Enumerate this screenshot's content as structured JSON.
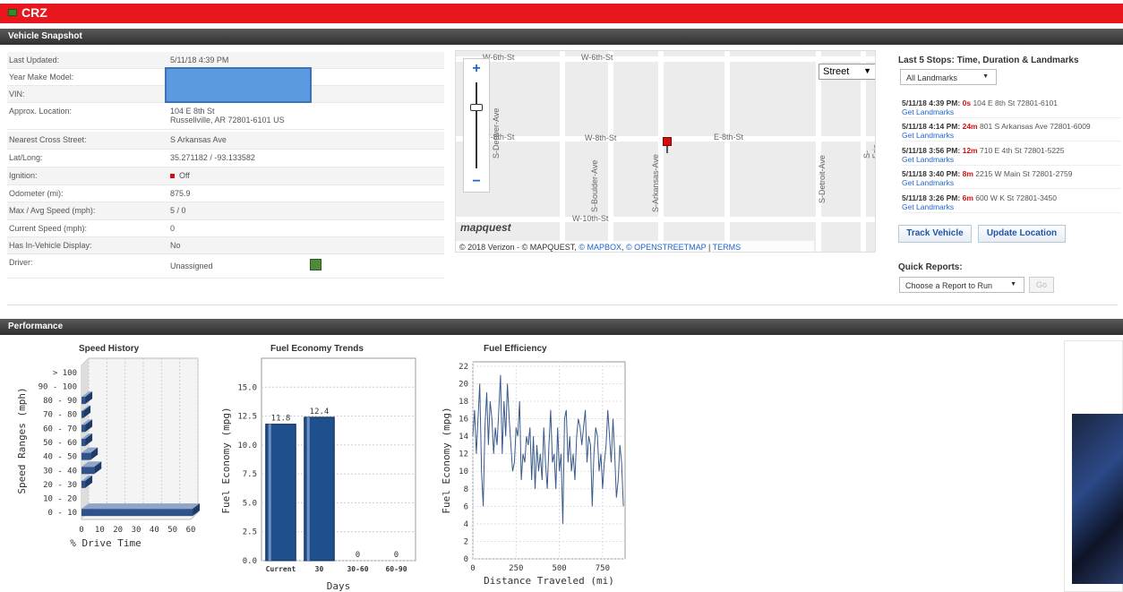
{
  "app": {
    "title": "CRZ"
  },
  "vehicle_section": {
    "title": "Vehicle Snapshot"
  },
  "vehicle_fields": [
    {
      "label": "Last Updated:",
      "value": "5/11/18 4:39 PM"
    },
    {
      "label": "Year Make Model:",
      "value": ""
    },
    {
      "label": "VIN:",
      "value": ""
    },
    {
      "label": "Approx. Location:",
      "value": "104 E 8th St",
      "value2": "Russellville, AR 72801-6101 US"
    },
    {
      "label": "Nearest Cross Street:",
      "value": "S Arkansas Ave"
    },
    {
      "label": "Lat/Long:",
      "value": "35.271182 / -93.133582"
    },
    {
      "label": "Ignition:",
      "value": "Off"
    },
    {
      "label": "Odometer (mi):",
      "value": "875.9"
    },
    {
      "label": "Max / Avg Speed (mph):",
      "value": "5 / 0"
    },
    {
      "label": "Current Speed (mph):",
      "value": "0"
    },
    {
      "label": "Has In-Vehicle Display:",
      "value": "No"
    },
    {
      "label": "Driver:",
      "value": "Unassigned"
    }
  ],
  "map": {
    "zoom_in": "+",
    "zoom_out": "−",
    "map_type": "Street",
    "streets": {
      "w6th_a": "W-6th-St",
      "w6th_b": "W-6th-St",
      "w8th_a": "W-8th-St",
      "w8th_b": "W-8th-St",
      "e8th": "E-8th-St",
      "w10th": "W-10th-St",
      "s_denver": "S-Denver-Ave",
      "s_boulder": "S-Boulder-Ave",
      "s_arkansas": "S-Arkansas-Ave",
      "s_detroit": "S-Detroit-Ave",
      "s_erie": "S-Erie-Ave"
    },
    "logo": "mapquest",
    "attribution": "© 2018 Verizon - © MAPQUEST, ",
    "attr_links": [
      "© MAPBOX",
      "© OPENSTREETMAP",
      "TERMS"
    ],
    "separator": " | "
  },
  "stops": {
    "title": "Last 5 Stops: Time, Duration & Landmarks",
    "filter": "All Landmarks",
    "items": [
      {
        "time": "5/11/18 4:39 PM:",
        "duration": "0s",
        "address": "104 E 8th St 72801-6101",
        "link": "Get Landmarks"
      },
      {
        "time": "5/11/18 4:14 PM:",
        "duration": "24m",
        "address": "801 S Arkansas Ave 72801-6009",
        "link": "Get Landmarks"
      },
      {
        "time": "5/11/18 3:56 PM:",
        "duration": "12m",
        "address": "710 E 4th St 72801-5225",
        "link": "Get Landmarks"
      },
      {
        "time": "5/11/18 3:40 PM:",
        "duration": "8m",
        "address": "2215 W Main St 72801-2759",
        "link": "Get Landmarks"
      },
      {
        "time": "5/11/18 3:26 PM:",
        "duration": "6m",
        "address": "600 W K St 72801-3450",
        "link": "Get Landmarks"
      }
    ],
    "track_button": "Track Vehicle",
    "update_button": "Update Location"
  },
  "quick_reports": {
    "title": "Quick Reports:",
    "select": "Choose a Report to Run",
    "go": "Go"
  },
  "performance_section": {
    "title": "Performance"
  },
  "chart_data": [
    {
      "type": "bar",
      "title": "Speed History",
      "orientation": "horizontal",
      "categories": [
        "0 - 10",
        "10 - 20",
        "20 - 30",
        "30 - 40",
        "40 - 50",
        "50 - 60",
        "60 - 70",
        "70 - 80",
        "80 - 90",
        "90 - 100",
        "> 100"
      ],
      "values": [
        61,
        0,
        2,
        7,
        5,
        2,
        2,
        1,
        2,
        0,
        0
      ],
      "xlabel": "% Drive Time",
      "ylabel": "Speed Ranges (mph)",
      "xticks": [
        "0",
        "10",
        "20",
        "30",
        "40",
        "50",
        "60"
      ],
      "xlim": [
        0,
        60
      ]
    },
    {
      "type": "bar",
      "title": "Fuel Economy Trends",
      "categories": [
        "Current",
        "30",
        "30-60",
        "60-90"
      ],
      "values": [
        11.8,
        12.4,
        0,
        0
      ],
      "data_labels": [
        "11.8",
        "12.4",
        "0",
        "0"
      ],
      "xlabel": "Days",
      "ylabel": "Fuel Economy (mpg)",
      "yticks": [
        "0.0",
        "2.5",
        "5.0",
        "7.5",
        "10.0",
        "12.5",
        "15.0"
      ],
      "ylim": [
        0,
        17.5
      ]
    },
    {
      "type": "line",
      "title": "Fuel Efficiency",
      "xlabel": "Distance Traveled (mi)",
      "ylabel": "Fuel Economy (mpg)",
      "xticks": [
        "0",
        "250",
        "500",
        "750"
      ],
      "yticks": [
        "0",
        "2",
        "4",
        "6",
        "8",
        "10",
        "12",
        "14",
        "16",
        "18",
        "20",
        "22"
      ],
      "xlim": [
        0,
        880
      ],
      "ylim": [
        0,
        22.5
      ],
      "x": [
        0,
        10,
        20,
        30,
        40,
        50,
        60,
        70,
        80,
        90,
        100,
        110,
        120,
        130,
        140,
        150,
        160,
        170,
        180,
        190,
        200,
        210,
        220,
        230,
        240,
        250,
        260,
        270,
        280,
        290,
        300,
        310,
        320,
        330,
        340,
        350,
        360,
        370,
        380,
        390,
        400,
        410,
        420,
        430,
        440,
        450,
        460,
        470,
        480,
        490,
        500,
        510,
        520,
        530,
        540,
        550,
        560,
        570,
        580,
        590,
        600,
        610,
        620,
        630,
        640,
        650,
        660,
        670,
        680,
        690,
        700,
        710,
        720,
        730,
        740,
        750,
        760,
        770,
        780,
        790,
        800,
        810,
        820,
        830,
        840,
        850,
        860,
        870
      ],
      "y": [
        14,
        17,
        12,
        16,
        20,
        10,
        6,
        15,
        19,
        13,
        18,
        16,
        12,
        15,
        13,
        17,
        21,
        12,
        18,
        14,
        20,
        16,
        13,
        10,
        11,
        15,
        14,
        18,
        9,
        12,
        11,
        14,
        13,
        15,
        9,
        14,
        8,
        13,
        10,
        12,
        9,
        15,
        11,
        8,
        13,
        17,
        11,
        12,
        8,
        15,
        10,
        12,
        4,
        16,
        17,
        11,
        14,
        10,
        12,
        9,
        14,
        16,
        15,
        13,
        15,
        17,
        11,
        14,
        13,
        6,
        12,
        15,
        14,
        10,
        12,
        8,
        11,
        13,
        17,
        14,
        11,
        16,
        12,
        7,
        9,
        13,
        11,
        6
      ]
    }
  ]
}
